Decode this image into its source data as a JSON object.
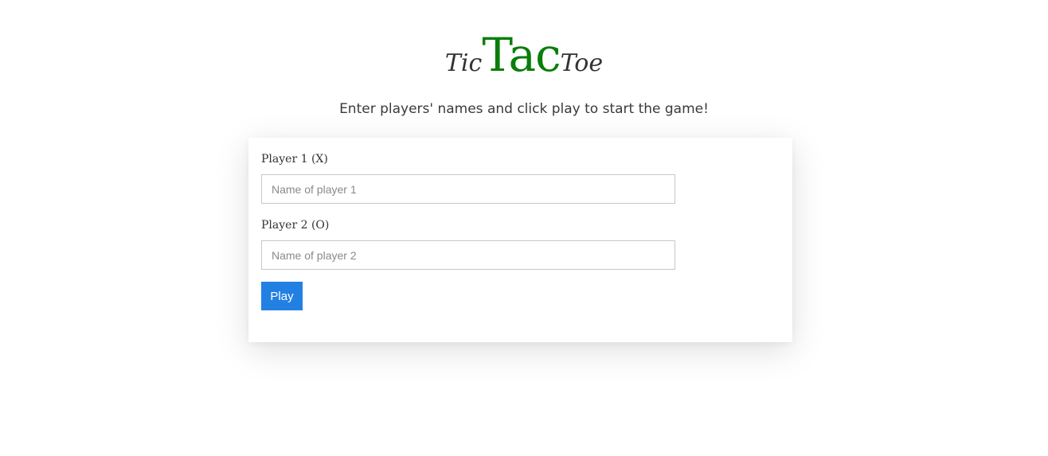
{
  "header": {
    "title_left": "Tic",
    "title_center": "Tac",
    "title_right": "Toe",
    "subtitle": "Enter players' names and click play to start the game!"
  },
  "form": {
    "player1_label": "Player 1 (X)",
    "player1_placeholder": "Name of player 1",
    "player1_value": "",
    "player2_label": "Player 2 (O)",
    "player2_placeholder": "Name of player 2",
    "player2_value": "",
    "play_label": "Play"
  },
  "colors": {
    "accent": "#0a7d0a",
    "button": "#2380e3"
  }
}
